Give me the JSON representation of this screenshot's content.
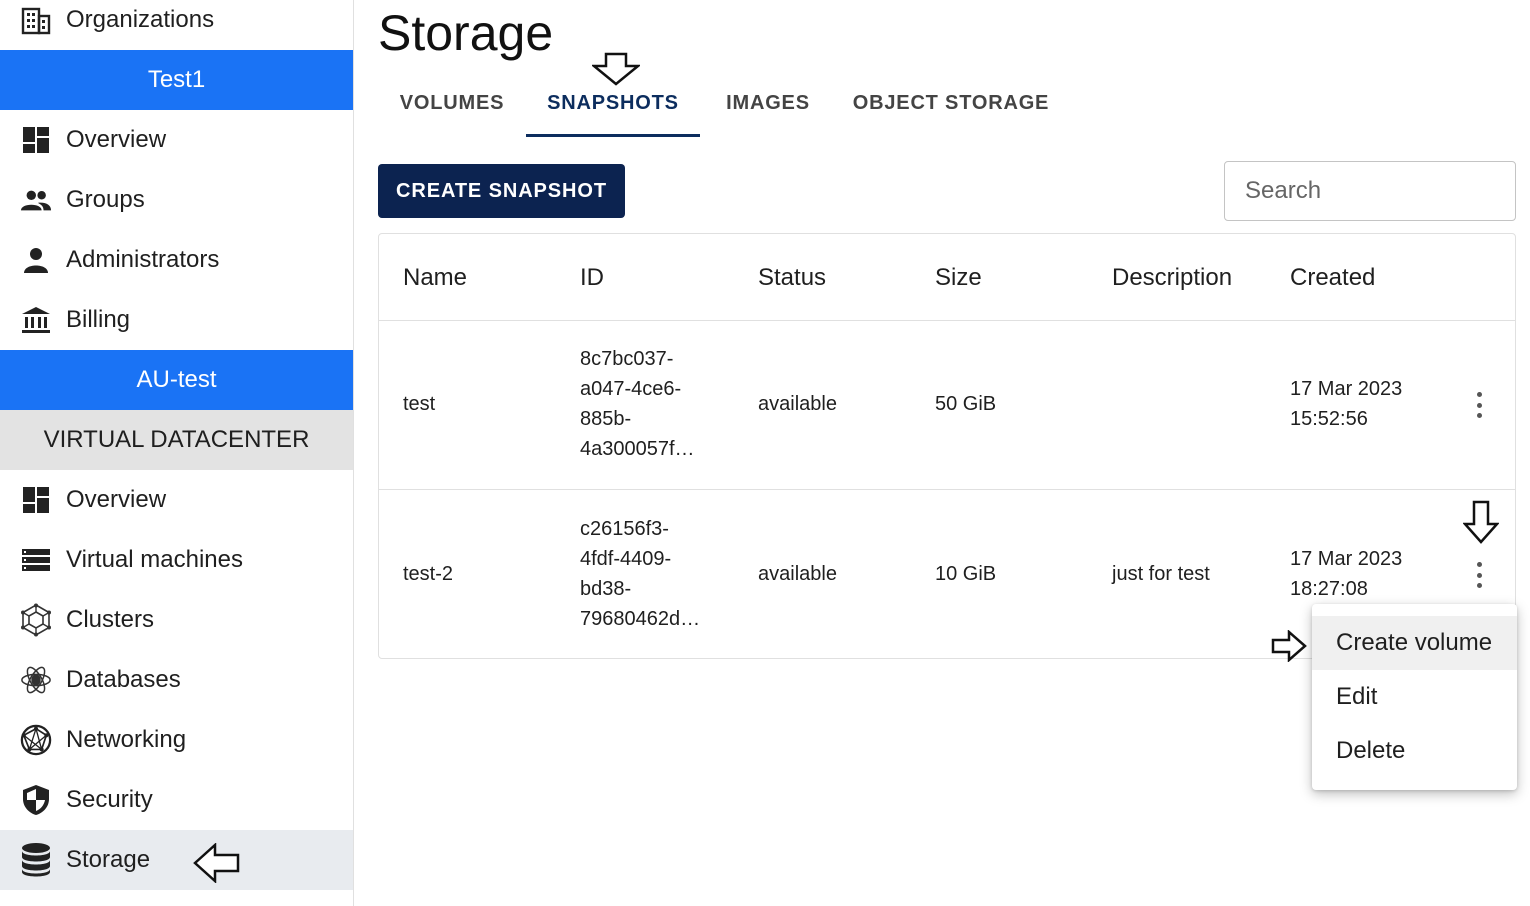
{
  "sidebar": {
    "org_label": "Organizations",
    "org_name": "Test1",
    "org_items": [
      {
        "label": "Overview",
        "icon": "dashboard-icon"
      },
      {
        "label": "Groups",
        "icon": "group-icon"
      },
      {
        "label": "Administrators",
        "icon": "person-icon"
      },
      {
        "label": "Billing",
        "icon": "bank-icon"
      }
    ],
    "project_name": "AU-test",
    "section_label": "VIRTUAL DATACENTER",
    "vdc_items": [
      {
        "label": "Overview",
        "icon": "dashboard-icon"
      },
      {
        "label": "Virtual machines",
        "icon": "list-icon"
      },
      {
        "label": "Clusters",
        "icon": "cluster-icon"
      },
      {
        "label": "Databases",
        "icon": "atom-icon"
      },
      {
        "label": "Networking",
        "icon": "globe-icon"
      },
      {
        "label": "Security",
        "icon": "shield-icon"
      },
      {
        "label": "Storage",
        "icon": "database-icon"
      }
    ],
    "active_item": "Storage"
  },
  "main": {
    "title": "Storage",
    "tabs": [
      {
        "label": "VOLUMES"
      },
      {
        "label": "SNAPSHOTS"
      },
      {
        "label": "IMAGES"
      },
      {
        "label": "OBJECT STORAGE"
      }
    ],
    "active_tab": "SNAPSHOTS",
    "create_button": "CREATE SNAPSHOT",
    "search_placeholder": "Search",
    "table": {
      "columns": [
        "Name",
        "ID",
        "Status",
        "Size",
        "Description",
        "Created"
      ],
      "rows": [
        {
          "name": "test",
          "id_lines": [
            "8c7bc037-",
            "a047-4ce6-",
            "885b-",
            "4a300057f…"
          ],
          "status": "available",
          "size": "50 GiB",
          "description": "",
          "created_lines": [
            "17 Mar 2023",
            "15:52:56"
          ]
        },
        {
          "name": "test-2",
          "id_lines": [
            "c26156f3-",
            "4fdf-4409-",
            "bd38-",
            "79680462d…"
          ],
          "status": "available",
          "size": "10 GiB",
          "description": "just for test",
          "created_lines": [
            "17 Mar 2023",
            "18:27:08"
          ]
        }
      ]
    },
    "context_menu": {
      "items": [
        "Create volume",
        "Edit",
        "Delete"
      ],
      "highlighted": "Create volume"
    }
  },
  "colors": {
    "primary_blue": "#1a73f5",
    "dark_navy": "#0c2350",
    "tab_active": "#0c2d5e"
  }
}
